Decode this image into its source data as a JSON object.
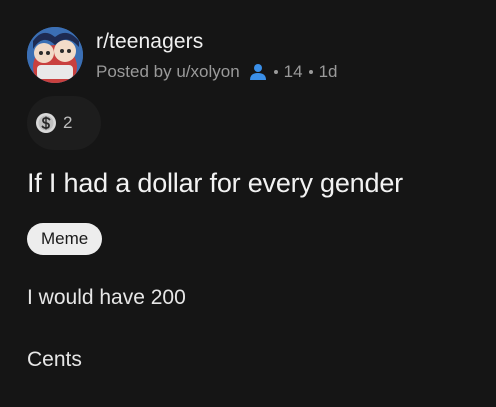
{
  "post": {
    "subreddit": "r/teenagers",
    "posted_by": "Posted by u/xolyon",
    "user_icon": "person-icon",
    "score": "14",
    "age": "1d",
    "award": {
      "icon": "silver-award-icon",
      "count": "2"
    },
    "title": "If I had a dollar for every gender",
    "flair": "Meme",
    "body": [
      "I would have 200",
      "Cents"
    ]
  },
  "colors": {
    "background": "#151515",
    "meta_text": "#9a9a9a",
    "user_icon": "#3a8fe8",
    "flair_bg": "#ededed"
  }
}
